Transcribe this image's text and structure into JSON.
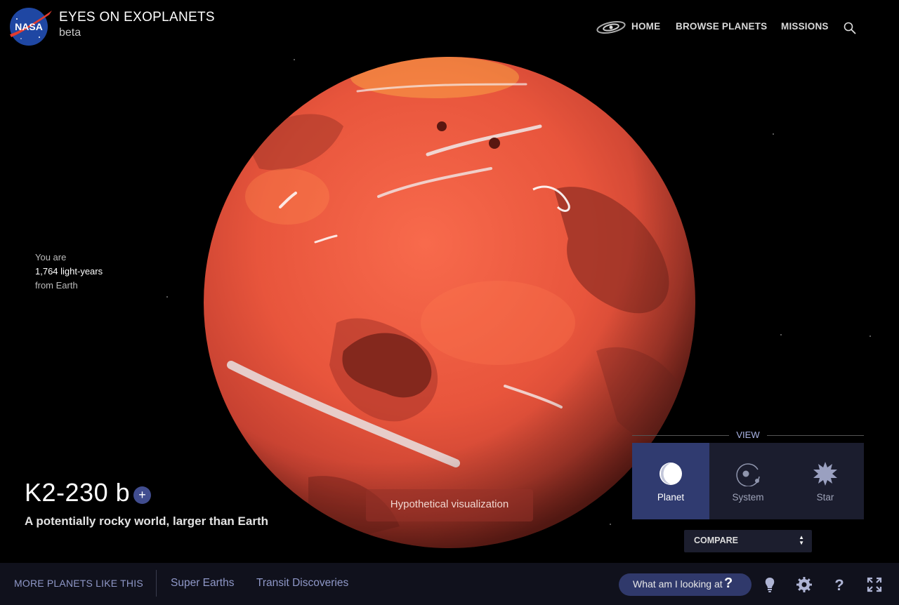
{
  "header": {
    "logo_text": "NASA",
    "title": "EYES ON EXOPLANETS",
    "subtitle": "beta",
    "nav": [
      {
        "label": "HOME",
        "icon": "galaxy-icon"
      },
      {
        "label": "BROWSE PLANETS"
      },
      {
        "label": "MISSIONS"
      }
    ],
    "search_icon": "search-icon"
  },
  "distance": {
    "line1": "You are",
    "value": "1,764 light-years",
    "line3": "from Earth"
  },
  "planet": {
    "name": "K2-230 b",
    "tagline": "A potentially rocky world, larger than Earth",
    "add_label": "+",
    "visualization_label": "Hypothetical visualization"
  },
  "view": {
    "label": "VIEW",
    "options": [
      {
        "label": "Planet",
        "icon": "planet-icon",
        "active": true
      },
      {
        "label": "System",
        "icon": "system-icon",
        "active": false
      },
      {
        "label": "Star",
        "icon": "star-icon",
        "active": false
      }
    ],
    "compare_label": "COMPARE"
  },
  "bottom_bar": {
    "more_label": "MORE PLANETS LIKE THIS",
    "links": [
      "Super Earths",
      "Transit Discoveries"
    ],
    "what_label": "What am I looking at",
    "what_icon": "?",
    "icons": [
      "lightbulb-icon",
      "settings-gear-icon",
      "help-icon",
      "fullscreen-icon"
    ]
  },
  "colors": {
    "accent_blue": "#303b70",
    "planet_base": "#e8553c",
    "text_link": "#8f98c8"
  }
}
